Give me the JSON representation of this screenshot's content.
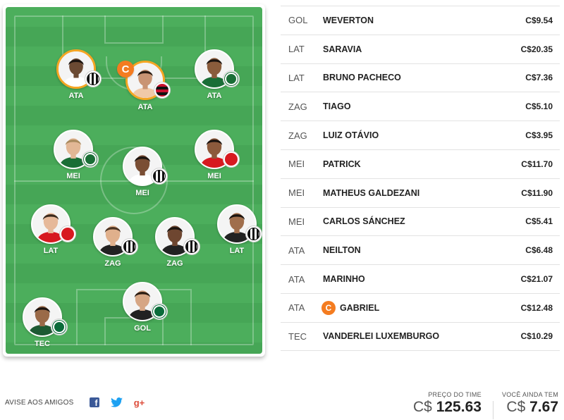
{
  "field": {
    "captain_mark": "C",
    "players": [
      {
        "id": "ata-left",
        "pos": "ATA",
        "club": "santos",
        "skin": "#6b4a33",
        "hair": "#1b1410",
        "shirt": "#ffffff",
        "ring": true
      },
      {
        "id": "ata-center",
        "pos": "ATA",
        "club": "flamengo",
        "skin": "#c99473",
        "hair": "#2a1c12",
        "shirt": "#f0c9a8",
        "ring": true,
        "captain": true
      },
      {
        "id": "ata-right",
        "pos": "ATA",
        "club": "coritiba",
        "skin": "#8a5c3c",
        "hair": "#1b1410",
        "shirt": "#1a6e36",
        "ring": false
      },
      {
        "id": "mei-left",
        "pos": "MEI",
        "club": "coritiba",
        "skin": "#e2b795",
        "hair": "#a98a5e",
        "shirt": "#1a6e36",
        "ring": false
      },
      {
        "id": "mei-center",
        "pos": "MEI",
        "club": "santos",
        "skin": "#7a4e34",
        "hair": "#1b1410",
        "shirt": "#ffffff",
        "ring": false
      },
      {
        "id": "mei-right",
        "pos": "MEI",
        "club": "inter",
        "skin": "#8c5a3c",
        "hair": "#1b1410",
        "shirt": "#d71920",
        "ring": false
      },
      {
        "id": "lat-left",
        "pos": "LAT",
        "club": "inter",
        "skin": "#e6b99a",
        "hair": "#3a2a1e",
        "shirt": "#d71920",
        "ring": false
      },
      {
        "id": "zag-left",
        "pos": "ZAG",
        "club": "ceara",
        "skin": "#e0b08c",
        "hair": "#4a3322",
        "shirt": "#222222",
        "ring": false
      },
      {
        "id": "zag-right",
        "pos": "ZAG",
        "club": "ceara",
        "skin": "#6e4630",
        "hair": "#1b1410",
        "shirt": "#222222",
        "ring": false
      },
      {
        "id": "lat-right",
        "pos": "LAT",
        "club": "ceara",
        "skin": "#a06e4c",
        "hair": "#1b1410",
        "shirt": "#222222",
        "ring": false
      },
      {
        "id": "tec",
        "pos": "TEC",
        "club": "palmeiras",
        "skin": "#9a6a48",
        "hair": "#1b1410",
        "shirt": "#1d5a33",
        "ring": false
      },
      {
        "id": "gol",
        "pos": "GOL",
        "club": "palmeiras",
        "skin": "#d6a684",
        "hair": "#2a1c12",
        "shirt": "#222222",
        "ring": false
      }
    ]
  },
  "lineup": [
    {
      "pos": "GOL",
      "name": "WEVERTON",
      "price": "C$9.54",
      "captain": false
    },
    {
      "pos": "LAT",
      "name": "SARAVIA",
      "price": "C$20.35",
      "captain": false
    },
    {
      "pos": "LAT",
      "name": "BRUNO PACHECO",
      "price": "C$7.36",
      "captain": false
    },
    {
      "pos": "ZAG",
      "name": "TIAGO",
      "price": "C$5.10",
      "captain": false
    },
    {
      "pos": "ZAG",
      "name": "LUIZ OTÁVIO",
      "price": "C$3.95",
      "captain": false
    },
    {
      "pos": "MEI",
      "name": "PATRICK",
      "price": "C$11.70",
      "captain": false
    },
    {
      "pos": "MEI",
      "name": "MATHEUS GALDEZANI",
      "price": "C$11.90",
      "captain": false
    },
    {
      "pos": "MEI",
      "name": "CARLOS SÁNCHEZ",
      "price": "C$5.41",
      "captain": false
    },
    {
      "pos": "ATA",
      "name": "NEILTON",
      "price": "C$6.48",
      "captain": false
    },
    {
      "pos": "ATA",
      "name": "MARINHO",
      "price": "C$21.07",
      "captain": false
    },
    {
      "pos": "ATA",
      "name": "GABRIEL",
      "price": "C$12.48",
      "captain": true
    },
    {
      "pos": "TEC",
      "name": "VANDERLEI LUXEMBURGO",
      "price": "C$10.29",
      "captain": false
    }
  ],
  "share": {
    "label": "AVISE AOS AMIGOS",
    "buttons": [
      {
        "name": "facebook",
        "glyph": "f",
        "color": "#3b5998"
      },
      {
        "name": "twitter",
        "glyph": "",
        "color": "#1da1f2"
      },
      {
        "name": "google-plus",
        "glyph": "g+",
        "color": "#dd4b39"
      }
    ]
  },
  "totals": {
    "price_label": "PREÇO DO TIME",
    "price_currency": "C$",
    "price_value": "125.63",
    "remaining_label": "VOCÊ AINDA TEM",
    "remaining_currency": "C$",
    "remaining_value": "7.67"
  },
  "colors": {
    "pitch": "#4cae5c",
    "captain": "#f47c20",
    "ring": "#f5a623"
  }
}
